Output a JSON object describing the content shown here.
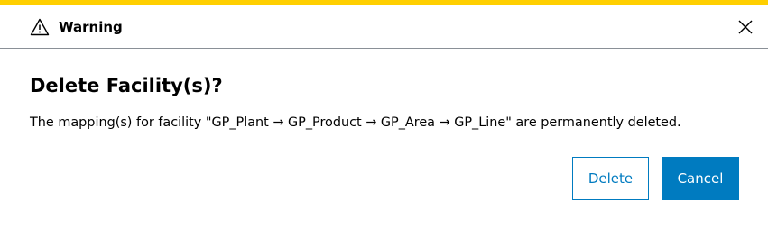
{
  "dialog": {
    "accent_color": "#ffcf00",
    "header": {
      "icon": "warning-triangle-icon",
      "title": "Warning",
      "close_icon": "close-icon"
    },
    "heading": "Delete Facility(s)?",
    "message": "The mapping(s) for facility \"GP_Plant → GP_Product → GP_Area → GP_Line\" are permanently deleted.",
    "buttons": {
      "delete_label": "Delete",
      "cancel_label": "Cancel"
    },
    "colors": {
      "primary": "#007bc0",
      "divider": "#8a9097"
    }
  }
}
